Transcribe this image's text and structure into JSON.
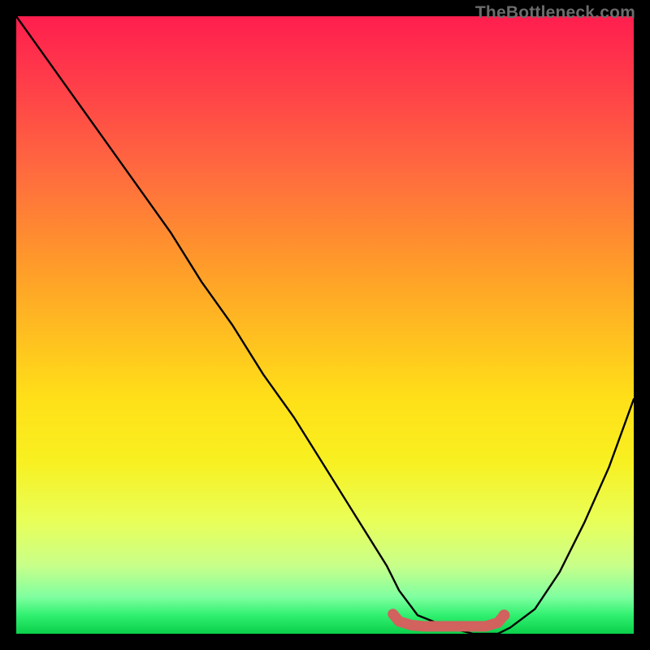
{
  "watermark": "TheBottleneck.com",
  "chart_data": {
    "type": "line",
    "title": "",
    "xlabel": "",
    "ylabel": "",
    "xlim": [
      0,
      100
    ],
    "ylim": [
      0,
      100
    ],
    "grid": false,
    "legend": false,
    "background_gradient": {
      "top": "#ff1e4e",
      "bottom": "#0ad04a",
      "description": "vertical red→orange→yellow→green gradient"
    },
    "series": [
      {
        "name": "bottleneck-curve",
        "color": "#000000",
        "x": [
          0,
          5,
          10,
          15,
          20,
          25,
          30,
          35,
          40,
          45,
          50,
          55,
          60,
          62,
          65,
          70,
          74,
          78,
          80,
          84,
          88,
          92,
          96,
          100
        ],
        "y": [
          100,
          93,
          86,
          79,
          72,
          65,
          57,
          50,
          42,
          35,
          27,
          19,
          11,
          7,
          3,
          1,
          0,
          0,
          1,
          4,
          10,
          18,
          27,
          38
        ]
      },
      {
        "name": "minimum-marker",
        "color": "#d1625e",
        "x": [
          61,
          62,
          64,
          66,
          68,
          70,
          72,
          74,
          76,
          78,
          79
        ],
        "y": [
          3.2,
          2.0,
          1.4,
          1.2,
          1.2,
          1.2,
          1.2,
          1.2,
          1.2,
          1.8,
          3.0
        ]
      }
    ],
    "annotation": {
      "minimum_region_x": [
        62,
        78
      ],
      "minimum_region_color": "#d1625e"
    }
  }
}
